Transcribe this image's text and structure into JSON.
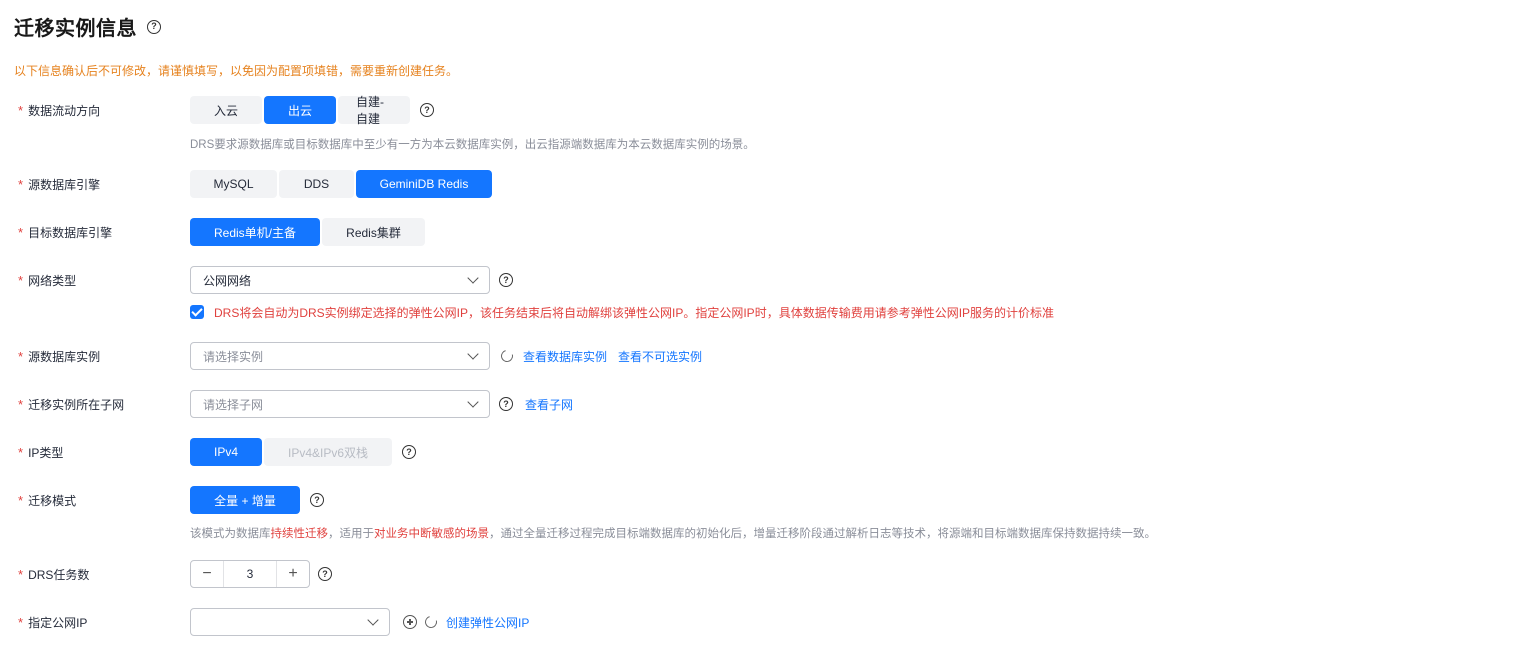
{
  "section": {
    "title": "迁移实例信息",
    "notice": "以下信息确认后不可修改，请谨慎填写，以免因为配置项填错，需要重新创建任务。"
  },
  "required_mark": "*",
  "flow_direction": {
    "label": "数据流动方向",
    "options": [
      "入云",
      "出云",
      "自建-自建"
    ],
    "selected": "出云",
    "hint": "DRS要求源数据库或目标数据库中至少有一方为本云数据库实例，出云指源端数据库为本云数据库实例的场景。"
  },
  "source_engine": {
    "label": "源数据库引擎",
    "options": [
      "MySQL",
      "DDS",
      "GeminiDB Redis"
    ],
    "selected": "GeminiDB Redis"
  },
  "target_engine": {
    "label": "目标数据库引擎",
    "options": [
      "Redis单机/主备",
      "Redis集群"
    ],
    "selected": "Redis单机/主备"
  },
  "network_type": {
    "label": "网络类型",
    "value": "公网网络",
    "checkbox_checked": true,
    "checkbox_text": "DRS将会自动为DRS实例绑定选择的弹性公网IP，该任务结束后将自动解绑该弹性公网IP。指定公网IP时，具体数据传输费用请参考弹性公网IP服务的计价标准"
  },
  "source_instance": {
    "label": "源数据库实例",
    "placeholder": "请选择实例",
    "link_view": "查看数据库实例",
    "link_unavailable": "查看不可选实例"
  },
  "subnet": {
    "label": "迁移实例所在子网",
    "placeholder": "请选择子网",
    "link_view": "查看子网"
  },
  "ip_type": {
    "label": "IP类型",
    "options": [
      "IPv4",
      "IPv4&IPv6双栈"
    ],
    "selected": "IPv4"
  },
  "migration_mode": {
    "label": "迁移模式",
    "value": "全量 + 增量",
    "hint_parts": [
      "该模式为数据库",
      "持续性迁移",
      "，适用于",
      "对业务中断敏感的场景",
      "，通过全量迁移过程完成目标端数据库的初始化后，增量迁移阶段通过解析日志等技术，将源端和目标端数据库保持数据持续一致。"
    ]
  },
  "task_count": {
    "label": "DRS任务数",
    "value": "3",
    "minus": "−",
    "plus": "+"
  },
  "public_ip": {
    "label": "指定公网IP",
    "value": "",
    "link_create": "创建弹性公网IP"
  },
  "icons": {
    "help": "?"
  }
}
